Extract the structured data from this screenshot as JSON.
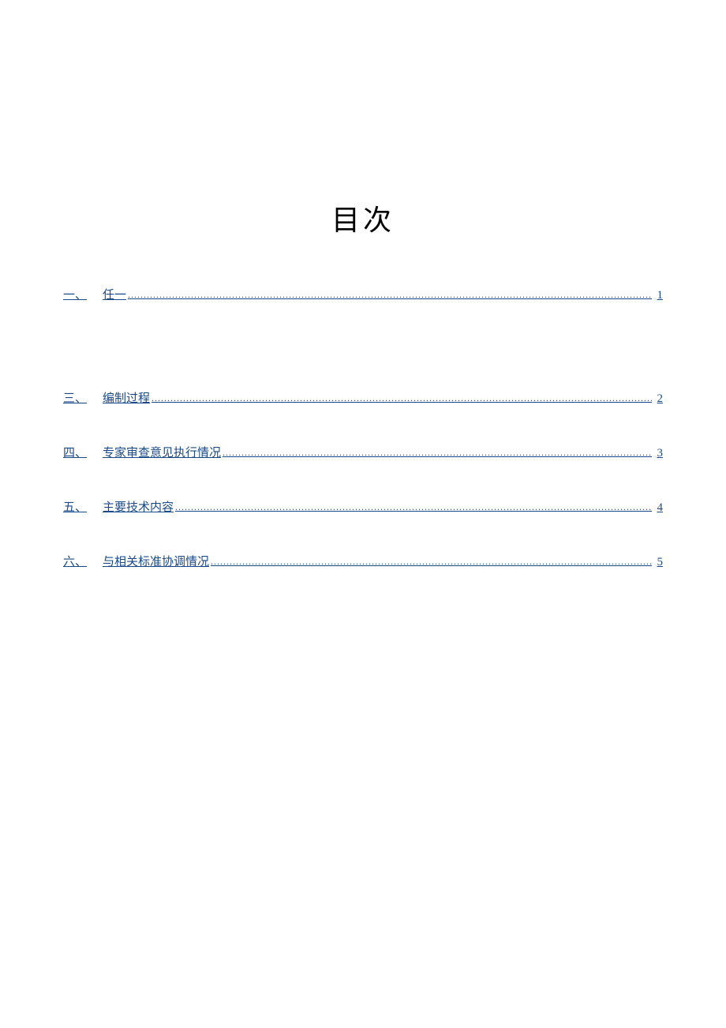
{
  "title": "目次",
  "toc": {
    "items": [
      {
        "number": "一、",
        "label": "任一",
        "page": "1"
      },
      {
        "number": "三、",
        "label": "编制过程",
        "page": "2"
      },
      {
        "number": "四、",
        "label": "专家审查意见执行情况",
        "page": "3"
      },
      {
        "number": "五、",
        "label": "主要技术内容",
        "page": "4"
      },
      {
        "number": "六、",
        "label": "与相关标准协调情况",
        "page": "5"
      }
    ]
  },
  "dots": "........................................................................................................................................................................................................................................"
}
